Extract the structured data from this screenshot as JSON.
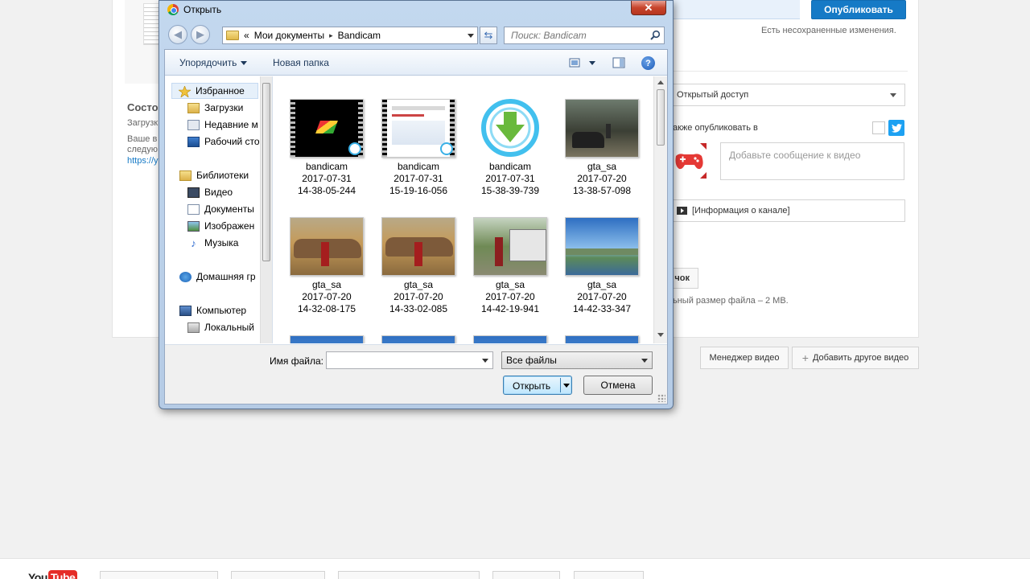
{
  "background_page": {
    "status_title": "Состо",
    "status_lines": [
      "Загрузк",
      "Ваше в",
      "следую"
    ],
    "status_link": "https://y",
    "publish_label": "Опубликовать",
    "unsaved_notice": "Есть несохраненные изменения.",
    "privacy_value": "Открытый доступ",
    "also_publish_label": "акже опубликовать в",
    "message_placeholder": "Добавьте сообщение к видео",
    "channel_info_label": "[Информация о канале]",
    "partial_button_label": "чок",
    "file_size_note": "ьный размер файла – 2 MB.",
    "video_manager_label": "Менеджер видео",
    "add_video_label": "Добавить другое видео",
    "logo_you": "You",
    "logo_tube": "Tube",
    "colors": {
      "accent": "#167ac6",
      "twitter": "#1da1f2",
      "brand_red": "#e52d27"
    }
  },
  "dialog": {
    "title": "Открыть",
    "close_glyph": "✕",
    "address": {
      "prefix": "«",
      "segments": [
        "Мои документы",
        "Bandicam"
      ],
      "separator": "▸"
    },
    "search_placeholder": "Поиск: Bandicam",
    "toolbar": {
      "organize": "Упорядочить",
      "new_folder": "Новая папка",
      "help": "?"
    },
    "nav": {
      "favorites": "Избранное",
      "downloads": "Загрузки",
      "recent": "Недавние м",
      "desktop": "Рабочий сто",
      "libraries": "Библиотеки",
      "video": "Видео",
      "documents": "Документы",
      "images": "Изображен",
      "music": "Музыка",
      "homegroup": "Домашняя гр",
      "computer": "Компьютер",
      "local_disk": "Локальный"
    },
    "files": [
      {
        "name": "bandicam",
        "date": "2017-07-31",
        "time": "14-38-05-244",
        "thumb": "video-black"
      },
      {
        "name": "bandicam",
        "date": "2017-07-31",
        "time": "15-19-16-056",
        "thumb": "video-web"
      },
      {
        "name": "bandicam",
        "date": "2017-07-31",
        "time": "15-38-39-739",
        "thumb": "bandicam-logo"
      },
      {
        "name": "gta_sa",
        "date": "2017-07-20",
        "time": "13-38-57-098",
        "thumb": "gta-street"
      },
      {
        "name": "gta_sa",
        "date": "2017-07-20",
        "time": "14-32-08-175",
        "thumb": "gta-car"
      },
      {
        "name": "gta_sa",
        "date": "2017-07-20",
        "time": "14-33-02-085",
        "thumb": "gta-car"
      },
      {
        "name": "gta_sa",
        "date": "2017-07-20",
        "time": "14-42-19-941",
        "thumb": "gta-bus"
      },
      {
        "name": "gta_sa",
        "date": "2017-07-20",
        "time": "14-42-33-347",
        "thumb": "sky-landscape"
      }
    ],
    "filename_label": "Имя файла:",
    "filename_value": "",
    "filter_value": "Все файлы",
    "open_label": "Открыть",
    "cancel_label": "Отмена"
  }
}
